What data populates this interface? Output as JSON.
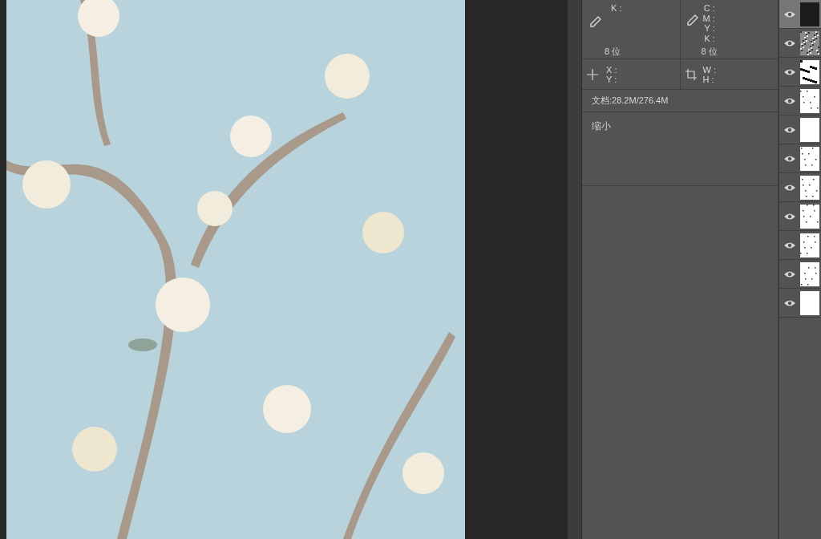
{
  "info": {
    "color_left": {
      "labels": [
        "K :"
      ],
      "depth": "8 位"
    },
    "color_right": {
      "labels": [
        "C :",
        "M :",
        "Y :",
        "K :"
      ],
      "depth": "8 位"
    },
    "position": {
      "labels": [
        "X :",
        "Y :"
      ]
    },
    "size": {
      "labels": [
        "W :",
        "H :"
      ]
    },
    "document": "文档:28.2M/276.4M",
    "status": "缩小"
  },
  "layers": [
    {
      "visible": true,
      "selected": true,
      "kind": "dark"
    },
    {
      "visible": true,
      "selected": false,
      "kind": "noise"
    },
    {
      "visible": true,
      "selected": false,
      "kind": "blotch"
    },
    {
      "visible": true,
      "selected": false,
      "kind": "speckle"
    },
    {
      "visible": true,
      "selected": false,
      "kind": "white"
    },
    {
      "visible": true,
      "selected": false,
      "kind": "speckle"
    },
    {
      "visible": true,
      "selected": false,
      "kind": "speckle"
    },
    {
      "visible": true,
      "selected": false,
      "kind": "speckle"
    },
    {
      "visible": true,
      "selected": false,
      "kind": "speckle"
    },
    {
      "visible": true,
      "selected": false,
      "kind": "speckle"
    },
    {
      "visible": true,
      "selected": false,
      "kind": "white"
    }
  ]
}
